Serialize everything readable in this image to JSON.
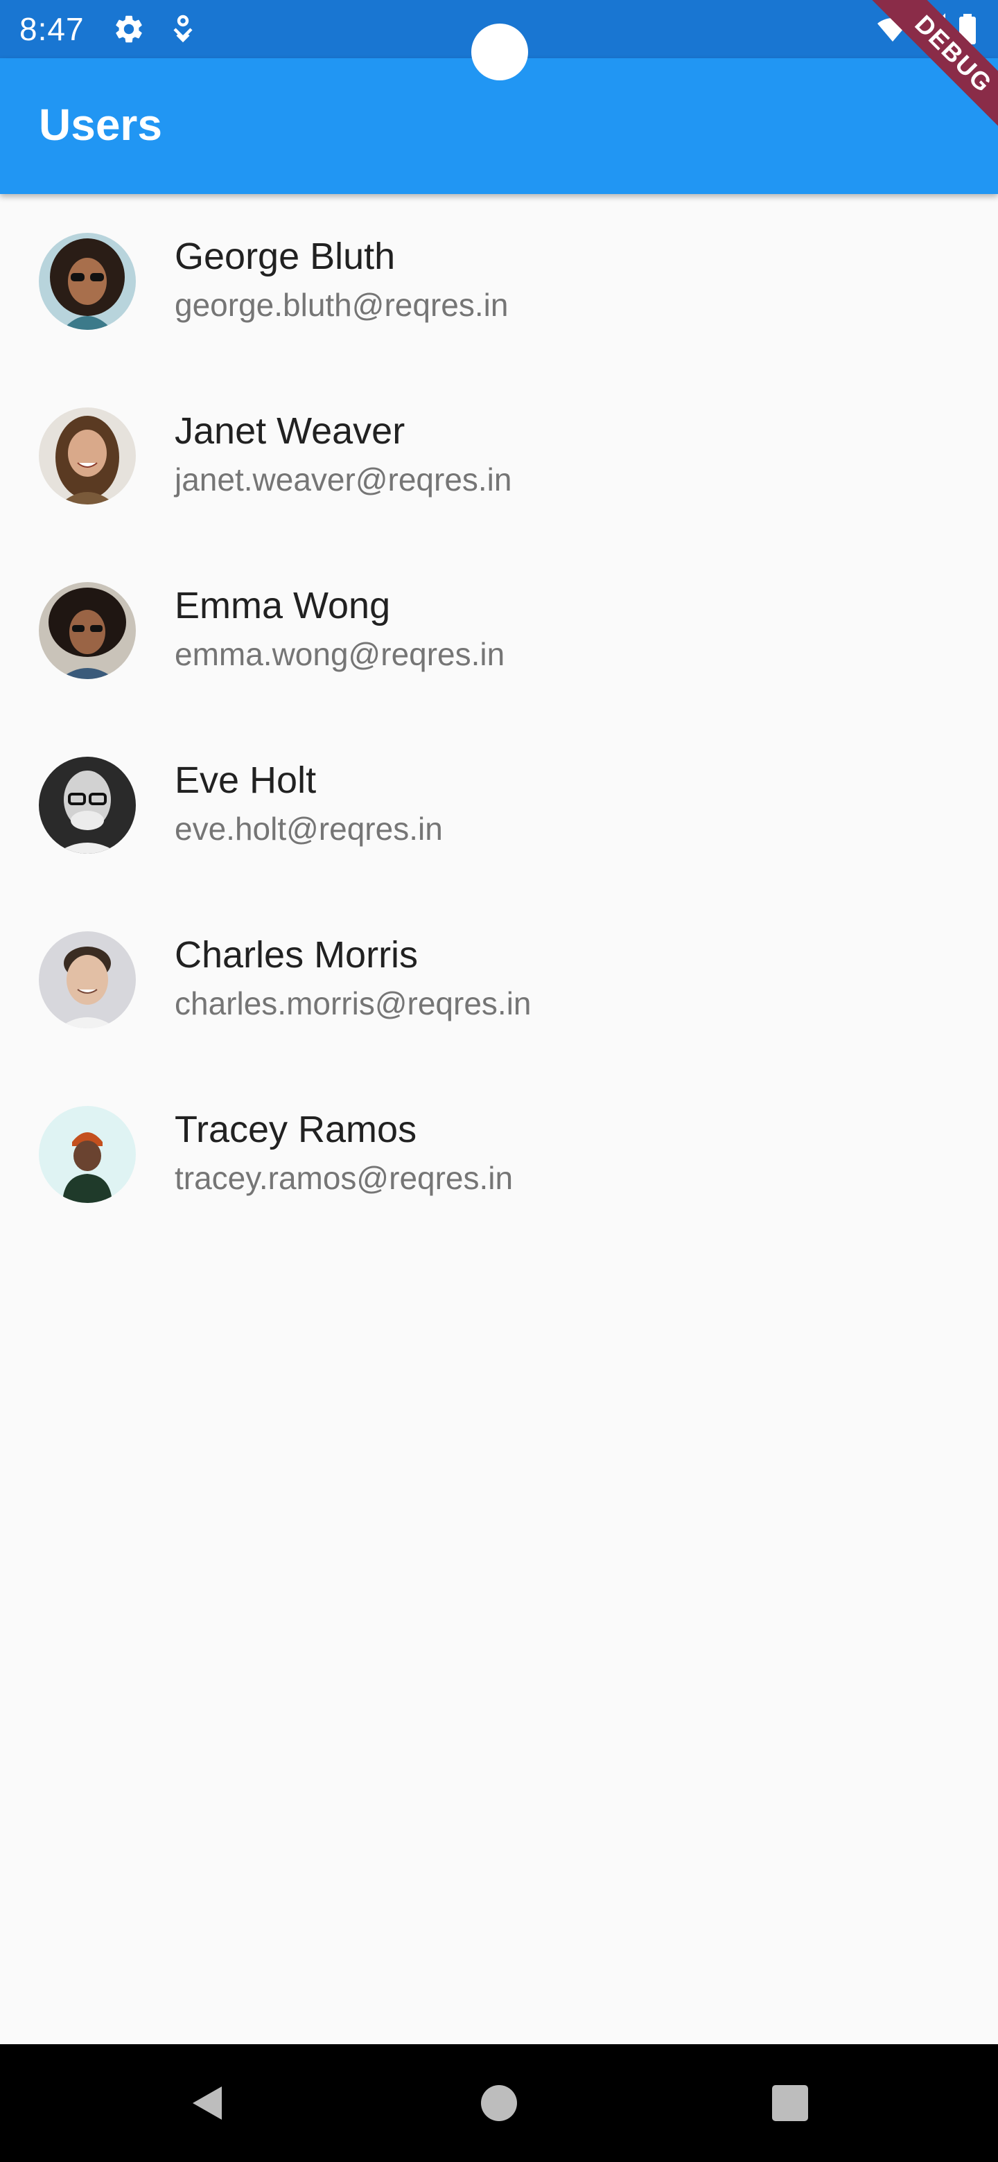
{
  "status_bar": {
    "time": "8:47",
    "left_icons": [
      "gear-icon",
      "vpn-key-icon"
    ],
    "right_icons": [
      "wifi-icon",
      "signal-icon",
      "battery-icon"
    ]
  },
  "debug_banner": "DEBUG",
  "app_bar": {
    "title": "Users",
    "color": "#2196f3"
  },
  "users": [
    {
      "name": "George Bluth",
      "email": "george.bluth@reqres.in"
    },
    {
      "name": "Janet Weaver",
      "email": "janet.weaver@reqres.in"
    },
    {
      "name": "Emma Wong",
      "email": "emma.wong@reqres.in"
    },
    {
      "name": "Eve Holt",
      "email": "eve.holt@reqres.in"
    },
    {
      "name": "Charles Morris",
      "email": "charles.morris@reqres.in"
    },
    {
      "name": "Tracey Ramos",
      "email": "tracey.ramos@reqres.in"
    }
  ],
  "nav_bar": {
    "buttons": [
      "back-icon",
      "home-icon",
      "recents-icon"
    ]
  },
  "colors": {
    "status_bar": "#1976d2",
    "app_bar": "#2196f3",
    "background": "#fafafa",
    "debug_banner": "#8a2c48"
  }
}
